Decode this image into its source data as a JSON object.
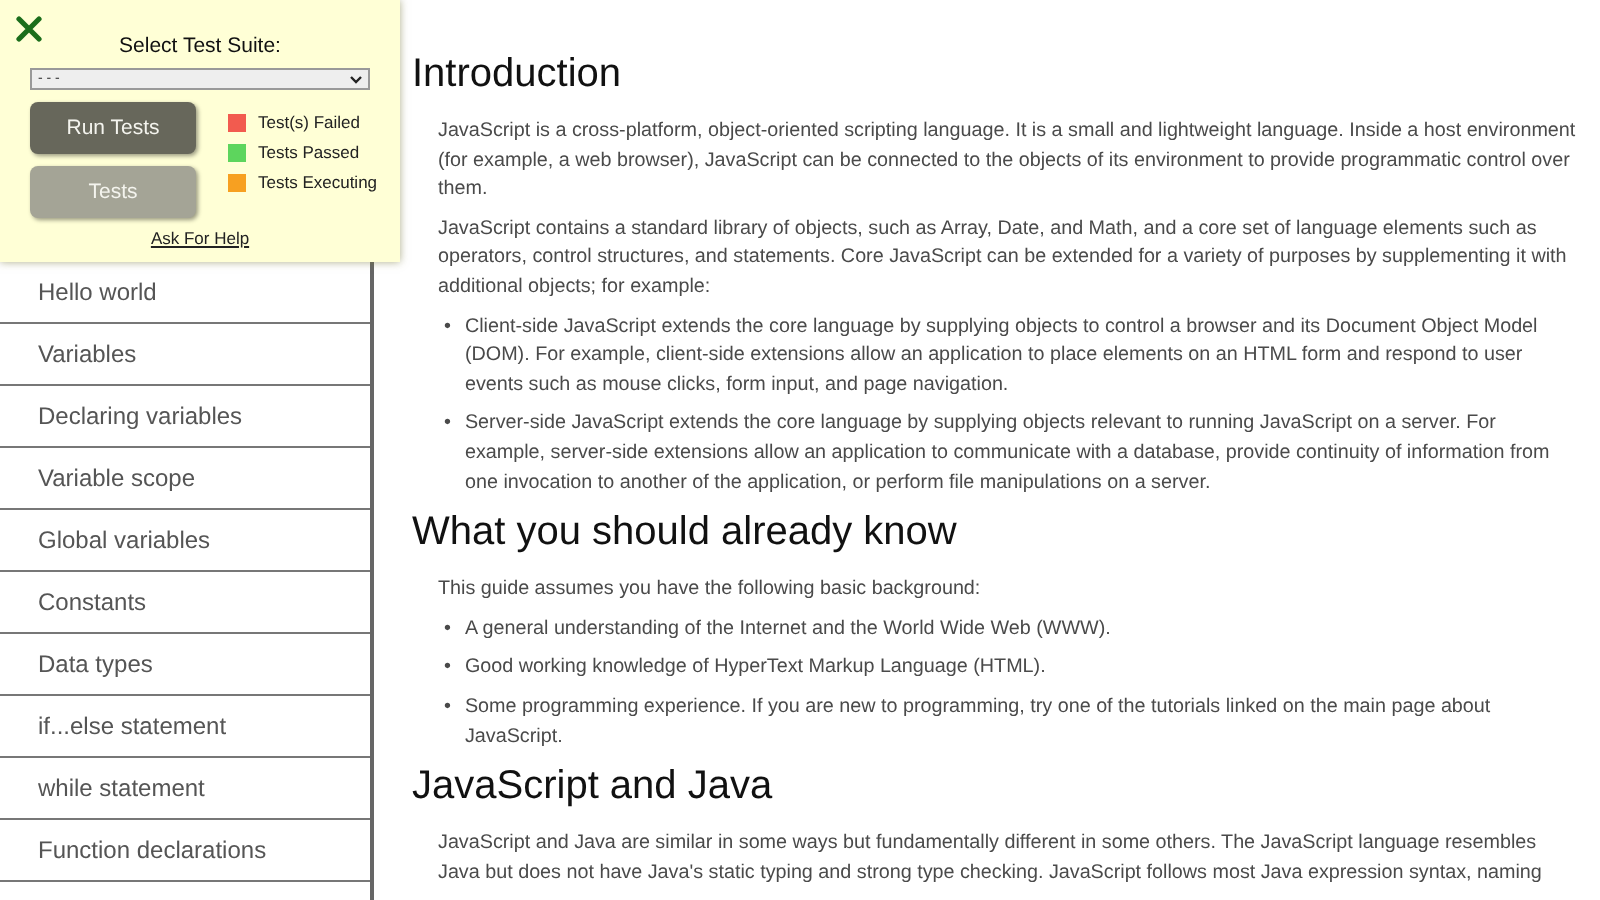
{
  "test_panel": {
    "label": "Select Test Suite:",
    "suite_select": {
      "value": "- - -"
    },
    "buttons": [
      {
        "label": "Run Tests",
        "kind": "primary"
      },
      {
        "label": "Tests",
        "kind": "secondary"
      }
    ],
    "legend": [
      {
        "label": "Test(s) Failed",
        "color": "#f25b4f"
      },
      {
        "label": "Tests Passed",
        "color": "#5dd55d"
      },
      {
        "label": "Tests Executing",
        "color": "#f7a021"
      }
    ],
    "help_link": "Ask For Help"
  },
  "sidebar": {
    "items": [
      {
        "label": "Hello world"
      },
      {
        "label": "Variables"
      },
      {
        "label": "Declaring variables"
      },
      {
        "label": "Variable scope"
      },
      {
        "label": "Global variables"
      },
      {
        "label": "Constants"
      },
      {
        "label": "Data types"
      },
      {
        "label": "if...else statement"
      },
      {
        "label": "while statement"
      },
      {
        "label": "Function declarations"
      }
    ]
  },
  "content": [
    {
      "kind": "heading",
      "text": "Introduction"
    },
    {
      "kind": "paragraph",
      "text": "JavaScript is a cross-platform, object-oriented scripting language. It is a small and lightweight language. Inside a host environment (for example, a web browser), JavaScript can be connected to the objects of its environment to provide programmatic control over them."
    },
    {
      "kind": "paragraph",
      "text": "JavaScript contains a standard library of objects, such as Array, Date, and Math, and a core set of language elements such as operators, control structures, and statements. Core JavaScript can be extended for a variety of purposes by supplementing it with additional objects; for example:"
    },
    {
      "kind": "list",
      "bullet": "•",
      "items": [
        "Client-side JavaScript extends the core language by supplying objects to control a browser and its Document Object Model (DOM). For example, client-side extensions allow an application to place elements on an HTML form and respond to user events such as mouse clicks, form input, and page navigation.",
        "Server-side JavaScript extends the core language by supplying objects relevant to running JavaScript on a server. For example, server-side extensions allow an application to communicate with a database, provide continuity of information from one invocation to another of the application, or perform file manipulations on a server."
      ]
    },
    {
      "kind": "heading",
      "text": "What you should already know"
    },
    {
      "kind": "paragraph",
      "text": "This guide assumes you have the following basic background:"
    },
    {
      "kind": "list",
      "bullet": "•",
      "items": [
        "A general understanding of the Internet and the World Wide Web (WWW).",
        "Good working knowledge of HyperText Markup Language (HTML).",
        "Some programming experience. If you are new to programming, try one of the tutorials linked on the main page about JavaScript."
      ]
    },
    {
      "kind": "heading",
      "text": "JavaScript and Java"
    },
    {
      "kind": "paragraph",
      "text": "JavaScript and Java are similar in some ways but fundamentally different in some others. The JavaScript language resembles Java but does not have Java's static typing and strong type checking. JavaScript follows most Java expression syntax, naming"
    }
  ]
}
